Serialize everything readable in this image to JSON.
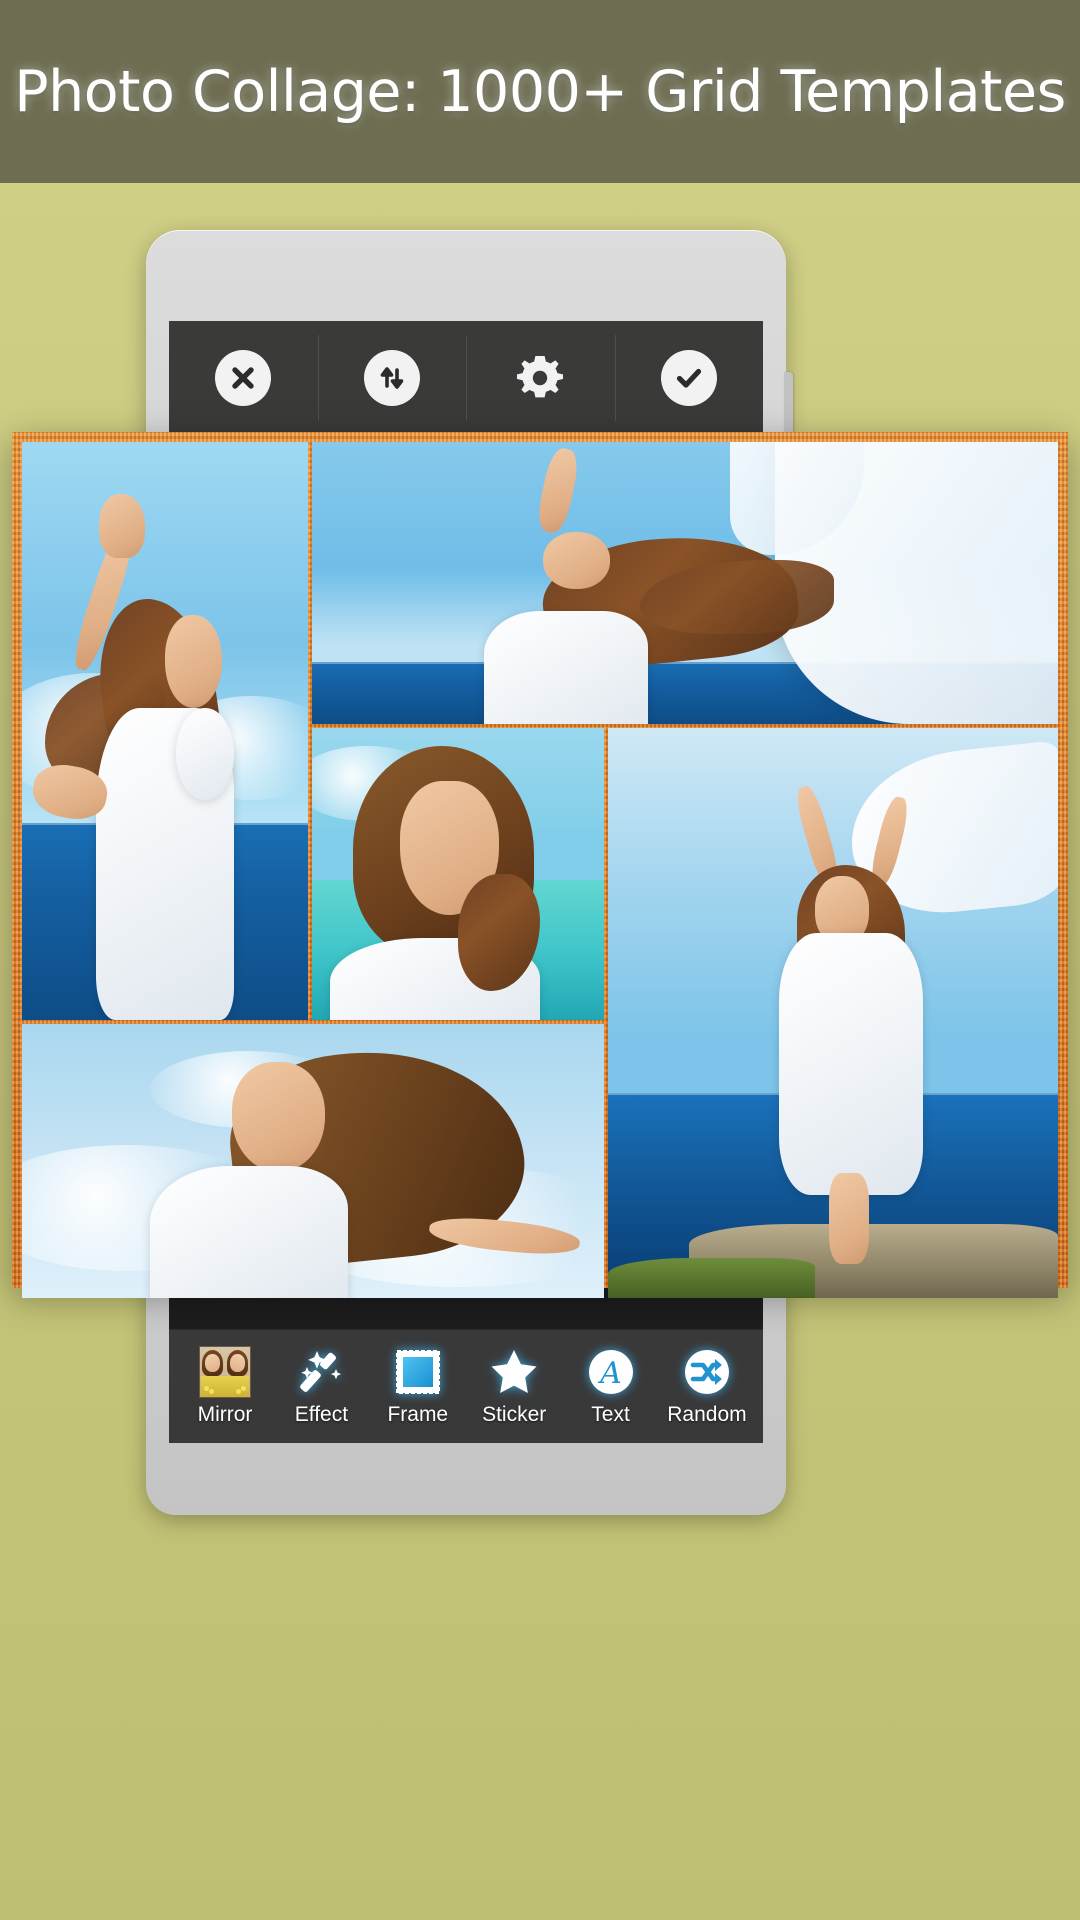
{
  "header": {
    "title": "Photo Collage: 1000+ Grid Templates",
    "background_color": "#6e6d52",
    "text_color": "#ffffff"
  },
  "page": {
    "background_color": "#c8c87a"
  },
  "device": {
    "name": "android-phone-mockup",
    "body_color": "#d2d2d2",
    "screen_background": "#1d1d1d"
  },
  "top_toolbar": {
    "background_color": "#3a3a38",
    "items": [
      {
        "name": "close",
        "icon": "close-icon",
        "label": "Close"
      },
      {
        "name": "swap",
        "icon": "swap-vertical-icon",
        "label": "Swap"
      },
      {
        "name": "settings",
        "icon": "gear-icon",
        "label": "Settings"
      },
      {
        "name": "confirm",
        "icon": "check-icon",
        "label": "Done"
      }
    ]
  },
  "collage": {
    "border_color": "#e87b1e",
    "border_style": "textured-orange",
    "cells": [
      {
        "id": 1,
        "alt": "Woman in white dress with arm raised by the sea",
        "position": "top-left-tall"
      },
      {
        "id": 2,
        "alt": "Woman holding white cloth banner against blue sky and sea",
        "position": "top-right-wide"
      },
      {
        "id": 3,
        "alt": "Smiling woman portrait with turquoise water background",
        "position": "center"
      },
      {
        "id": 4,
        "alt": "Woman in white dress on cliff holding white scarf",
        "position": "right-tall"
      },
      {
        "id": 5,
        "alt": "Smiling woman with windblown hair against clouds",
        "position": "bottom-wide"
      }
    ]
  },
  "bottom_toolbar": {
    "background_color": "#39393a",
    "accent_color": "#2eaae0",
    "items": [
      {
        "label": "Mirror",
        "icon": "mirror-thumbnail-icon"
      },
      {
        "label": "Effect",
        "icon": "magic-wand-icon"
      },
      {
        "label": "Frame",
        "icon": "frame-stamp-icon"
      },
      {
        "label": "Sticker",
        "icon": "star-icon"
      },
      {
        "label": "Text",
        "icon": "text-a-icon"
      },
      {
        "label": "Random",
        "icon": "shuffle-icon"
      }
    ]
  }
}
